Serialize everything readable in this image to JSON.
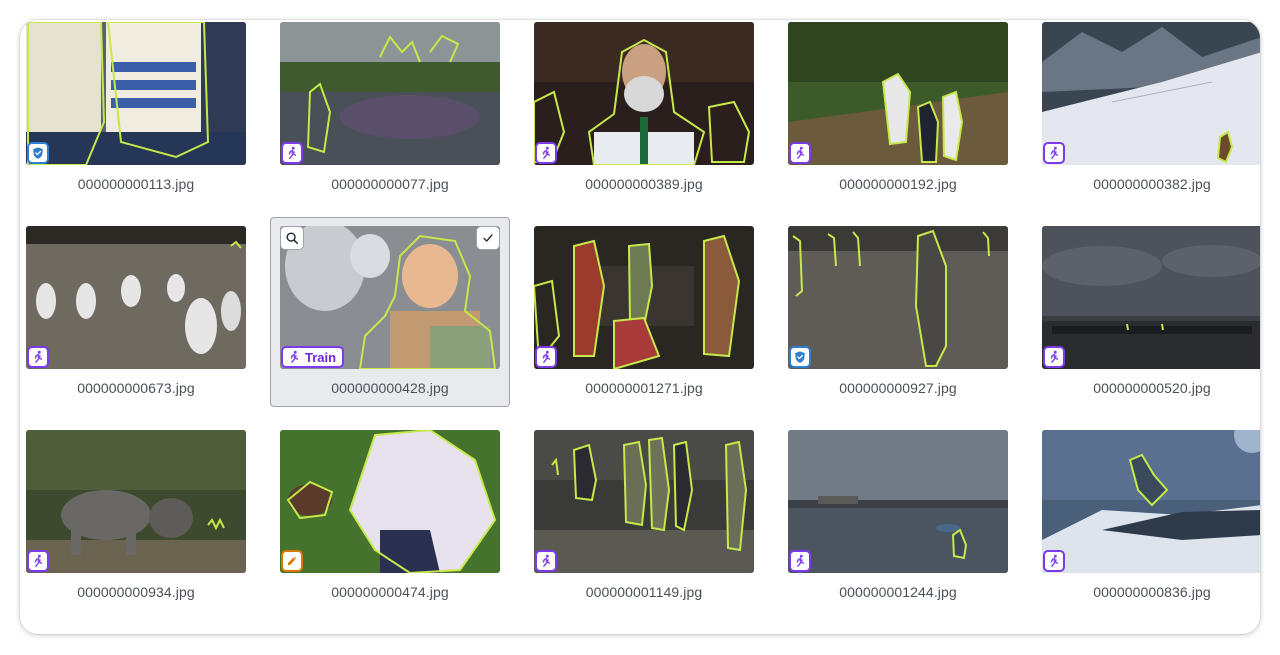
{
  "gallery": {
    "selected_index": 6,
    "hover_badge_label": "Train",
    "images": [
      {
        "filename": "000000000113.jpg",
        "split": "valid",
        "icon": "shield-icon",
        "scene": "people-sweaters"
      },
      {
        "filename": "000000000077.jpg",
        "split": "train",
        "icon": "runner-icon",
        "scene": "skatepark"
      },
      {
        "filename": "000000000389.jpg",
        "split": "train",
        "icon": "runner-icon",
        "scene": "bearded-man"
      },
      {
        "filename": "000000000192.jpg",
        "split": "train",
        "icon": "runner-icon",
        "scene": "baseball"
      },
      {
        "filename": "000000000382.jpg",
        "split": "train",
        "icon": "runner-icon",
        "scene": "snow-mountain"
      },
      {
        "filename": "000000000673.jpg",
        "split": "train",
        "icon": "runner-icon",
        "scene": "surfboards-beach"
      },
      {
        "filename": "000000000428.jpg",
        "split": "train",
        "icon": "runner-icon",
        "scene": "baby-balloon"
      },
      {
        "filename": "000000001271.jpg",
        "split": "train",
        "icon": "runner-icon",
        "scene": "party-people"
      },
      {
        "filename": "000000000927.jpg",
        "split": "valid",
        "icon": "shield-icon",
        "scene": "beach-walkers"
      },
      {
        "filename": "000000000520.jpg",
        "split": "train",
        "icon": "runner-icon",
        "scene": "pier-dusk"
      },
      {
        "filename": "000000000934.jpg",
        "split": "train",
        "icon": "runner-icon",
        "scene": "elephants"
      },
      {
        "filename": "000000000474.jpg",
        "split": "test",
        "icon": "pencil-icon",
        "scene": "child-baseball"
      },
      {
        "filename": "000000001149.jpg",
        "split": "train",
        "icon": "runner-icon",
        "scene": "military-group"
      },
      {
        "filename": "000000001244.jpg",
        "split": "train",
        "icon": "runner-icon",
        "scene": "flooded-lake"
      },
      {
        "filename": "000000000836.jpg",
        "split": "train",
        "icon": "runner-icon",
        "scene": "snowboard-jump"
      }
    ],
    "colors": {
      "train": "#7c3aed",
      "valid": "#2f7fd0",
      "test": "#d97706",
      "annotation_outline": "#c6e84a"
    }
  }
}
